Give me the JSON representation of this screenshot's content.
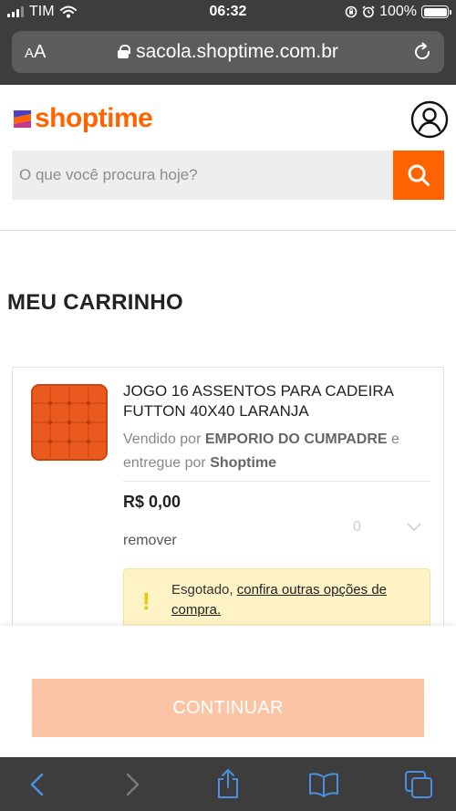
{
  "status_bar": {
    "carrier": "TIM",
    "time": "06:32",
    "battery": "100%",
    "battery_level": 1.0
  },
  "browser": {
    "text_size_label": "A",
    "text_size_label_large": "A",
    "url": "sacola.shoptime.com.br",
    "icons": [
      "lock-icon",
      "reload-icon",
      "back-icon",
      "forward-icon",
      "share-icon",
      "bookmarks-icon",
      "tabs-icon"
    ]
  },
  "header": {
    "logo_text": "shoptime",
    "search_placeholder": "O que você procura hoje?",
    "search_value": ""
  },
  "page": {
    "title": "MEU CARRINHO"
  },
  "cart": {
    "items": [
      {
        "name": "JOGO 16 ASSENTOS PARA CADEIRA FUTTON 40X40 LARANJA",
        "sold_by_prefix": "Vendido por",
        "seller": "EMPORIO DO CUMPADRE",
        "sold_by_and": "e",
        "delivered_by_prefix": "entregue por",
        "delivered_by": "Shoptime",
        "price": "R$ 0,00",
        "remove_label": "remover",
        "quantity": "0",
        "alert": {
          "status": "Esgotado,",
          "link_text": "confira outras opções de compra."
        }
      }
    ]
  },
  "footer": {
    "continue_label": "CONTINUAR"
  },
  "colors": {
    "brand_orange": "#ff6400",
    "continue_button": "#fbc5a5",
    "alert_background": "#fdf3c4",
    "alert_icon": "#f2c300",
    "browser_chrome": "#3d3d3d"
  }
}
